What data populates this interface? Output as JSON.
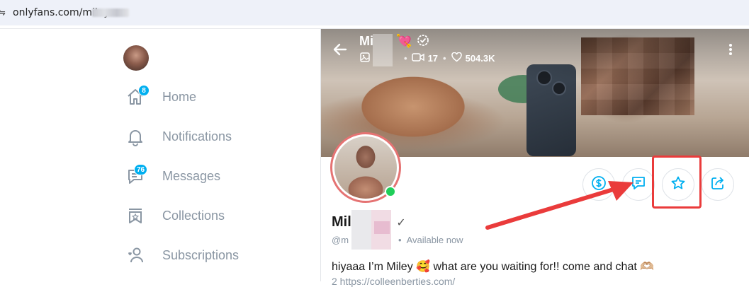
{
  "browser": {
    "url": "onlyfans.com/miley"
  },
  "sidebar": {
    "items": [
      {
        "label": "Home",
        "icon": "home-icon",
        "badge": "8"
      },
      {
        "label": "Notifications",
        "icon": "bell-icon",
        "badge": null
      },
      {
        "label": "Messages",
        "icon": "message-icon",
        "badge": "76"
      },
      {
        "label": "Collections",
        "icon": "collections-icon",
        "badge": null
      },
      {
        "label": "Subscriptions",
        "icon": "user-heart-icon",
        "badge": null
      }
    ]
  },
  "cover": {
    "name": "Mi",
    "name_emoji": "💘",
    "videos": "17",
    "likes": "504.3K"
  },
  "profile": {
    "name": "Mil",
    "handle": "@m",
    "status": "Available now",
    "bio": "hiyaaa I’m Miley 🥰 what are you waiting for!! come and chat 🫶🏼",
    "link_fragment": "2 https://colleenberties.com/"
  },
  "actions": [
    {
      "name": "tip-button",
      "icon": "dollar-icon"
    },
    {
      "name": "message-button",
      "icon": "chat-icon"
    },
    {
      "name": "favorite-button",
      "icon": "star-icon"
    },
    {
      "name": "share-button",
      "icon": "share-icon"
    }
  ],
  "colors": {
    "accent": "#00aff0",
    "highlight": "#ea3b3b",
    "nav_text": "#8a96a3",
    "online": "#1fce59"
  }
}
